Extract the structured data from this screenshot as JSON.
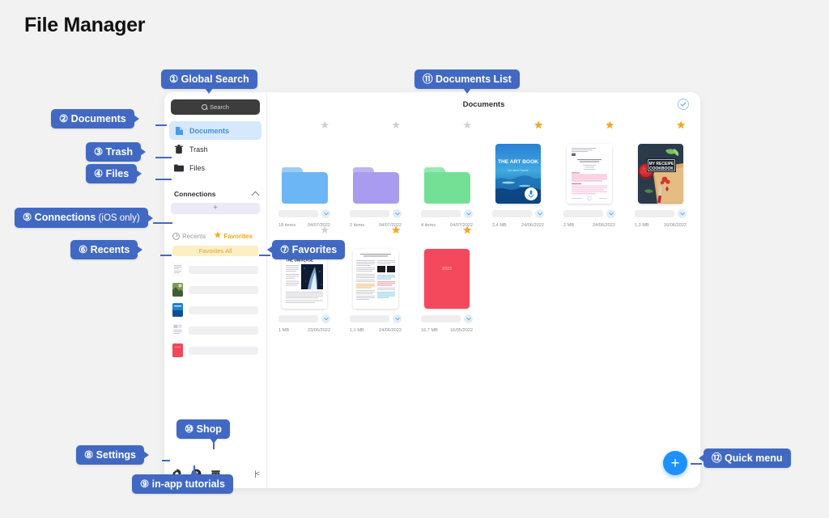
{
  "page": {
    "title": "File Manager"
  },
  "app": {
    "sidebar": {
      "search": {
        "label": "Search",
        "icon": "search-icon"
      },
      "nav": [
        {
          "label": "Documents",
          "icon": "document-icon",
          "active": true
        },
        {
          "label": "Trash",
          "icon": "trash-icon",
          "active": false
        },
        {
          "label": "Files",
          "icon": "folder-icon",
          "active": false
        }
      ],
      "connections": {
        "label": "Connections",
        "add_label": "+",
        "chevron": "chevron-up-icon"
      },
      "tabs": [
        {
          "label": "Recents",
          "icon": "clock-icon",
          "active": false
        },
        {
          "label": "Favorites",
          "icon": "star-icon",
          "active": true
        }
      ],
      "favorites_chip": "Favorites All",
      "favorite_rows": [
        {
          "thumb": "document-thumb"
        },
        {
          "thumb": "photo-thumb"
        },
        {
          "thumb": "book-thumb"
        },
        {
          "thumb": "article-thumb"
        },
        {
          "thumb": "red-cover-thumb"
        }
      ],
      "bottom_icons": [
        {
          "name": "gear-icon",
          "label": "Settings"
        },
        {
          "name": "help-circle-icon",
          "label": "In-app tutorials"
        },
        {
          "name": "shop-icon",
          "label": "Shop"
        }
      ],
      "collapse_icon": "collapse-panel-icon"
    },
    "main": {
      "title": "Documents",
      "select_all_icon": "check-circle-icon",
      "fab": {
        "label": "+",
        "name": "quick-menu-button"
      },
      "items": [
        {
          "kind": "folder",
          "color": "#6cb6f5",
          "tab_color": "#9ccdf9",
          "starred": false,
          "count": "18 items",
          "date": "04/07/2022"
        },
        {
          "kind": "folder",
          "color": "#a99cf0",
          "tab_color": "#bdb3f5",
          "starred": false,
          "count": "2 items",
          "date": "04/07/2022"
        },
        {
          "kind": "folder",
          "color": "#73e096",
          "tab_color": "#95e9af",
          "starred": false,
          "count": "4 items",
          "date": "04/07/2022"
        },
        {
          "kind": "art-book",
          "title": "THE ART BOOK",
          "subtitle": "Art and Travel",
          "starred": true,
          "size": "2,4 MB",
          "date": "24/06/2022",
          "badge": "microphone-icon"
        },
        {
          "kind": "pink-paper",
          "starred": true,
          "size": "2 MB",
          "date": "24/06/2022"
        },
        {
          "kind": "cookbook",
          "title": "MY RECEIPE COOKBOOK",
          "starred": true,
          "size": "1,3 MB",
          "date": "16/06/2022"
        },
        {
          "kind": "universe-article",
          "title": "THE BEGINNING OF THE UNIVERSE",
          "starred": false,
          "size": "1 MB",
          "date": "23/06/2022"
        },
        {
          "kind": "two-column-paper",
          "starred": true,
          "size": "1,1 MB",
          "date": "24/06/2022"
        },
        {
          "kind": "red-planner",
          "title": "2023",
          "starred": true,
          "size": "16,7 MB",
          "date": "16/05/2022"
        }
      ]
    }
  },
  "callouts": [
    {
      "id": 1,
      "text": "① Global Search"
    },
    {
      "id": 2,
      "text": "② Documents"
    },
    {
      "id": 3,
      "text": "③ Trash"
    },
    {
      "id": 4,
      "text": "④ Files"
    },
    {
      "id": 5,
      "text": "⑤ Connections",
      "sub": " (iOS only)"
    },
    {
      "id": 6,
      "text": "⑥ Recents"
    },
    {
      "id": 7,
      "text": "⑦ Favorites"
    },
    {
      "id": 8,
      "text": "⑧ Settings"
    },
    {
      "id": 9,
      "text": "⑨ in-app tutorials"
    },
    {
      "id": 10,
      "text": "⑩ Shop"
    },
    {
      "id": 11,
      "text": "⑪ Documents List"
    },
    {
      "id": 12,
      "text": "⑫ Quick menu"
    }
  ],
  "colors": {
    "callout": "#4169c4",
    "accent": "#1e90ff",
    "star": "#f5a623"
  }
}
